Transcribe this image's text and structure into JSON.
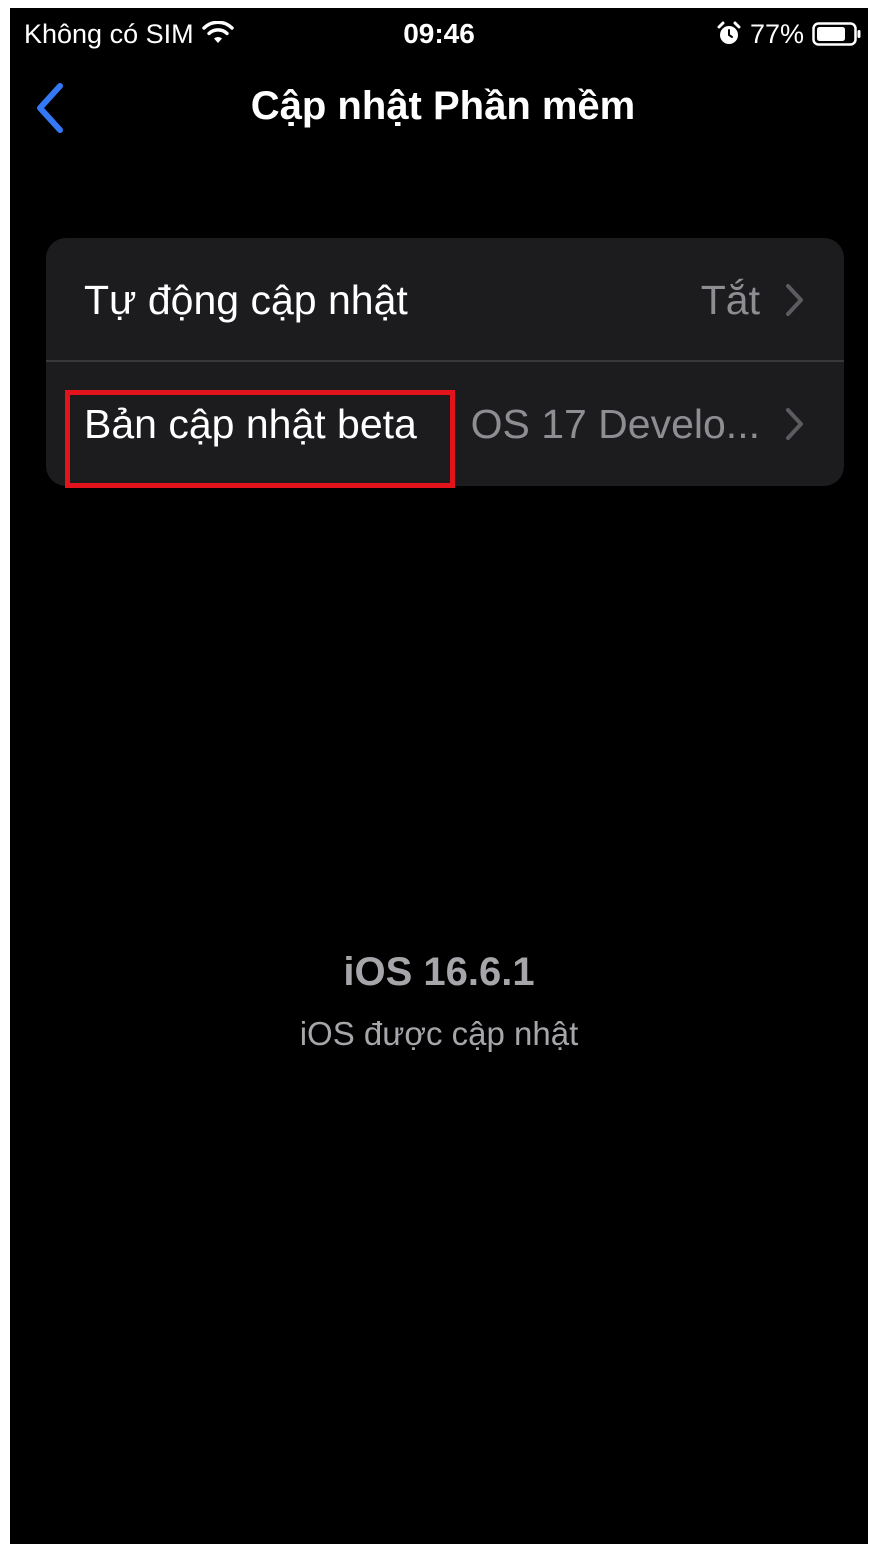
{
  "status_bar": {
    "carrier": "Không có SIM",
    "time": "09:46",
    "battery": "77%",
    "icons": [
      "wifi-icon",
      "alarm-icon",
      "battery-icon"
    ]
  },
  "nav": {
    "back_icon": "chevron-left-icon",
    "title": "Cập nhật Phần mềm"
  },
  "settings": {
    "rows": [
      {
        "label": "Tự động cập nhật",
        "value": "Tắt"
      },
      {
        "label": "Bản cập nhật beta",
        "value": "OS 17 Develo..."
      }
    ]
  },
  "version": {
    "title": "iOS 16.6.1",
    "subtitle": "iOS được cập nhật"
  },
  "colors": {
    "accent": "#3478f6",
    "background": "#000000",
    "group_background": "#1c1c1e",
    "highlight": "#e3131b"
  }
}
